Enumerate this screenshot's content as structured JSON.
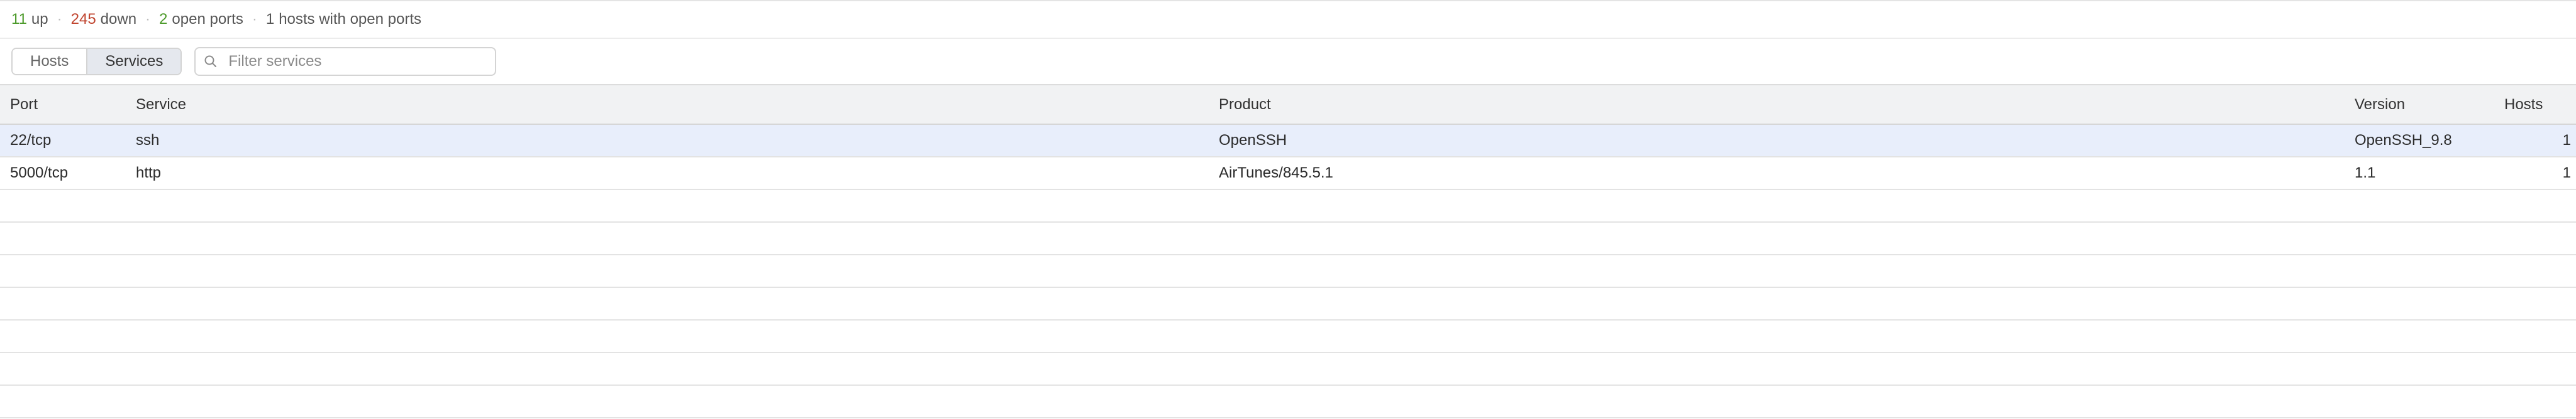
{
  "summary": {
    "up_count": "11",
    "up_label": "up",
    "down_count": "245",
    "down_label": "down",
    "open_ports_count": "2",
    "open_ports_label": "open ports",
    "hosts_open_count": "1",
    "hosts_open_label": "hosts with open ports",
    "separator": "·",
    "colors": {
      "up": "#4c9a2a",
      "down": "#c0442f"
    }
  },
  "toolbar": {
    "tabs": [
      {
        "label": "Hosts",
        "active": false
      },
      {
        "label": "Services",
        "active": true
      }
    ],
    "search": {
      "placeholder": "Filter services",
      "value": "",
      "icon": "search-icon"
    }
  },
  "table": {
    "columns": [
      "Port",
      "Service",
      "Product",
      "Version",
      "Hosts"
    ],
    "rows": [
      {
        "port": "22/tcp",
        "service": "ssh",
        "product": "OpenSSH",
        "version": "OpenSSH_9.8",
        "hosts": "1",
        "selected": true
      },
      {
        "port": "5000/tcp",
        "service": "http",
        "product": "AirTunes/845.5.1",
        "version": "1.1",
        "hosts": "1",
        "selected": false
      }
    ],
    "empty_rows": 7
  }
}
